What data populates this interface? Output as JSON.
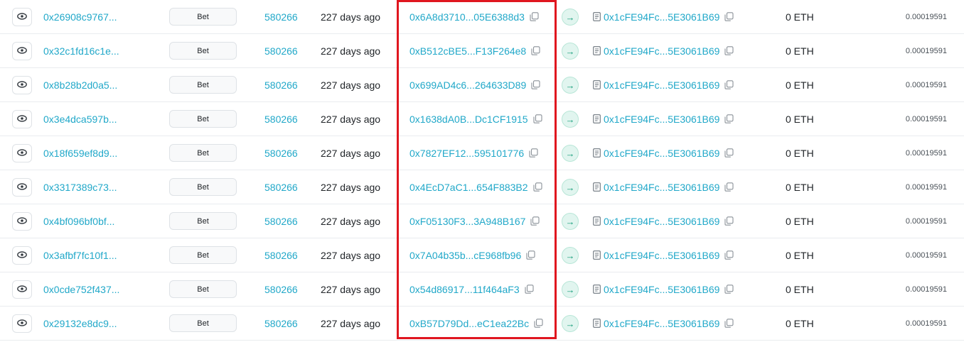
{
  "transactions": [
    {
      "hash": "0x26908c9767...",
      "method": "Bet",
      "block": "580266",
      "age": "227 days ago",
      "from": "0x6A8d3710...05E6388d3",
      "to": "0x1cFE94Fc...5E3061B69",
      "value": "0 ETH",
      "fee": "0.00019591"
    },
    {
      "hash": "0x32c1fd16c1e...",
      "method": "Bet",
      "block": "580266",
      "age": "227 days ago",
      "from": "0xB512cBE5...F13F264e8",
      "to": "0x1cFE94Fc...5E3061B69",
      "value": "0 ETH",
      "fee": "0.00019591"
    },
    {
      "hash": "0x8b28b2d0a5...",
      "method": "Bet",
      "block": "580266",
      "age": "227 days ago",
      "from": "0x699AD4c6...264633D89",
      "to": "0x1cFE94Fc...5E3061B69",
      "value": "0 ETH",
      "fee": "0.00019591"
    },
    {
      "hash": "0x3e4dca597b...",
      "method": "Bet",
      "block": "580266",
      "age": "227 days ago",
      "from": "0x1638dA0B...Dc1CF1915",
      "to": "0x1cFE94Fc...5E3061B69",
      "value": "0 ETH",
      "fee": "0.00019591"
    },
    {
      "hash": "0x18f659ef8d9...",
      "method": "Bet",
      "block": "580266",
      "age": "227 days ago",
      "from": "0x7827EF12...595101776",
      "to": "0x1cFE94Fc...5E3061B69",
      "value": "0 ETH",
      "fee": "0.00019591"
    },
    {
      "hash": "0x3317389c73...",
      "method": "Bet",
      "block": "580266",
      "age": "227 days ago",
      "from": "0x4EcD7aC1...654F883B2",
      "to": "0x1cFE94Fc...5E3061B69",
      "value": "0 ETH",
      "fee": "0.00019591"
    },
    {
      "hash": "0x4bf096bf0bf...",
      "method": "Bet",
      "block": "580266",
      "age": "227 days ago",
      "from": "0xF05130F3...3A948B167",
      "to": "0x1cFE94Fc...5E3061B69",
      "value": "0 ETH",
      "fee": "0.00019591"
    },
    {
      "hash": "0x3afbf7fc10f1...",
      "method": "Bet",
      "block": "580266",
      "age": "227 days ago",
      "from": "0x7A04b35b...cE968fb96",
      "to": "0x1cFE94Fc...5E3061B69",
      "value": "0 ETH",
      "fee": "0.00019591"
    },
    {
      "hash": "0x0cde752f437...",
      "method": "Bet",
      "block": "580266",
      "age": "227 days ago",
      "from": "0x54d86917...11f464aF3",
      "to": "0x1cFE94Fc...5E3061B69",
      "value": "0 ETH",
      "fee": "0.00019591"
    },
    {
      "hash": "0x29132e8dc9...",
      "method": "Bet",
      "block": "580266",
      "age": "227 days ago",
      "from": "0xB57D79Dd...eC1ea22Bc",
      "to": "0x1cFE94Fc...5E3061B69",
      "value": "0 ETH",
      "fee": "0.00019591"
    }
  ],
  "icons": {
    "view": "eye-icon",
    "copy": "copy-icon",
    "direction": "arrow-right-icon",
    "contract": "contract-document-icon"
  },
  "colors": {
    "link": "#21a8c9",
    "highlight_border": "#e0161f",
    "arrow_badge_bg": "#e1f5ef",
    "arrow_badge_fg": "#0f9a76"
  }
}
